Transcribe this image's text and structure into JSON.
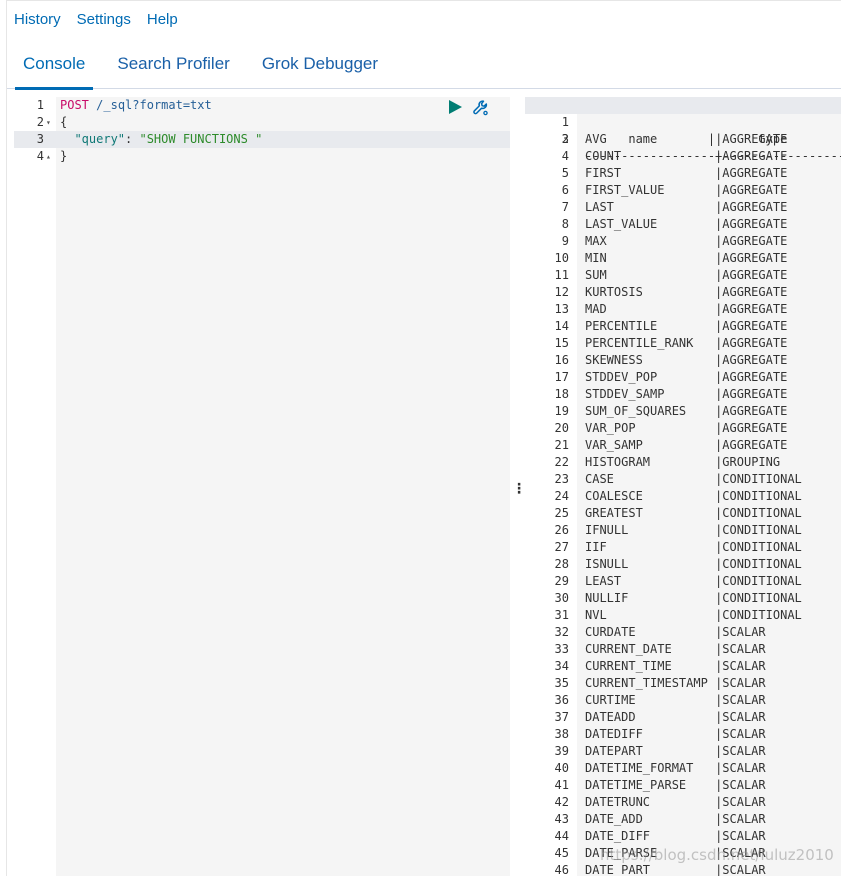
{
  "top_menu": [
    "History",
    "Settings",
    "Help"
  ],
  "tabs": [
    {
      "label": "Console",
      "active": true
    },
    {
      "label": "Search Profiler",
      "active": false
    },
    {
      "label": "Grok Debugger",
      "active": false
    }
  ],
  "colors": {
    "accent": "#006bb4",
    "method": "#c80a68",
    "string": "#2d8b2b",
    "key": "#0f7876"
  },
  "editor": {
    "method": "POST",
    "url": "/_sql?format=txt",
    "open_brace": "{",
    "close_brace": "}",
    "query_key": "\"query\"",
    "query_value": "\"SHOW FUNCTIONS \"",
    "line_numbers": [
      "1",
      "2",
      "3",
      "4"
    ],
    "icons": [
      "play-icon",
      "wrench-icon"
    ]
  },
  "output": {
    "header_name": "name",
    "header_type": "type",
    "separator": "------------------+-----------------",
    "rows": [
      [
        "AVG",
        "AGGREGATE"
      ],
      [
        "COUNT",
        "AGGREGATE"
      ],
      [
        "FIRST",
        "AGGREGATE"
      ],
      [
        "FIRST_VALUE",
        "AGGREGATE"
      ],
      [
        "LAST",
        "AGGREGATE"
      ],
      [
        "LAST_VALUE",
        "AGGREGATE"
      ],
      [
        "MAX",
        "AGGREGATE"
      ],
      [
        "MIN",
        "AGGREGATE"
      ],
      [
        "SUM",
        "AGGREGATE"
      ],
      [
        "KURTOSIS",
        "AGGREGATE"
      ],
      [
        "MAD",
        "AGGREGATE"
      ],
      [
        "PERCENTILE",
        "AGGREGATE"
      ],
      [
        "PERCENTILE_RANK",
        "AGGREGATE"
      ],
      [
        "SKEWNESS",
        "AGGREGATE"
      ],
      [
        "STDDEV_POP",
        "AGGREGATE"
      ],
      [
        "STDDEV_SAMP",
        "AGGREGATE"
      ],
      [
        "SUM_OF_SQUARES",
        "AGGREGATE"
      ],
      [
        "VAR_POP",
        "AGGREGATE"
      ],
      [
        "VAR_SAMP",
        "AGGREGATE"
      ],
      [
        "HISTOGRAM",
        "GROUPING"
      ],
      [
        "CASE",
        "CONDITIONAL"
      ],
      [
        "COALESCE",
        "CONDITIONAL"
      ],
      [
        "GREATEST",
        "CONDITIONAL"
      ],
      [
        "IFNULL",
        "CONDITIONAL"
      ],
      [
        "IIF",
        "CONDITIONAL"
      ],
      [
        "ISNULL",
        "CONDITIONAL"
      ],
      [
        "LEAST",
        "CONDITIONAL"
      ],
      [
        "NULLIF",
        "CONDITIONAL"
      ],
      [
        "NVL",
        "CONDITIONAL"
      ],
      [
        "CURDATE",
        "SCALAR"
      ],
      [
        "CURRENT_DATE",
        "SCALAR"
      ],
      [
        "CURRENT_TIME",
        "SCALAR"
      ],
      [
        "CURRENT_TIMESTAMP",
        "SCALAR"
      ],
      [
        "CURTIME",
        "SCALAR"
      ],
      [
        "DATEADD",
        "SCALAR"
      ],
      [
        "DATEDIFF",
        "SCALAR"
      ],
      [
        "DATEPART",
        "SCALAR"
      ],
      [
        "DATETIME_FORMAT",
        "SCALAR"
      ],
      [
        "DATETIME_PARSE",
        "SCALAR"
      ],
      [
        "DATETRUNC",
        "SCALAR"
      ],
      [
        "DATE_ADD",
        "SCALAR"
      ],
      [
        "DATE_DIFF",
        "SCALAR"
      ],
      [
        "DATE_PARSE",
        "SCALAR"
      ],
      [
        "DATE_PART",
        "SCALAR"
      ]
    ]
  },
  "watermark": "https://blog.csdn.net/luluz2010"
}
